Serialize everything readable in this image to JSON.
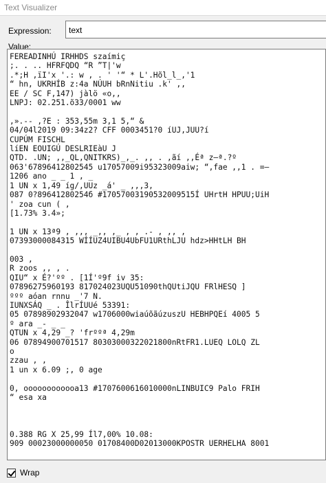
{
  "window": {
    "title": "Text Visualizer"
  },
  "expression": {
    "label": "Expression:",
    "value": "text"
  },
  "value": {
    "label": "Value:",
    "text": "FEREADINHÚ IRHHDS szaímiç\n;. . .. HFRFQDQ “R ”T|'w\n.*;H ,ïI'x '.: w , . ' '“ * L'.Hõl_l_,'1\n“ hn, UKRHÍB z:4a NÚUH bRnNitiu .k' ,,\nEE / SC F,147) jàlö «o,,\nLNPJ: 02.251.õ33/0001 ww\n\n,».-- ,?E : 353,55m 3,1 5,“ &\n04/04l2019 09:34z2? CFF 0003451?0 íUJ,JUU?í\nCUPÚM FISCHL\nlíEN EOUIGÚ DESLRIEàU J\nQTD. .UN; ,,_QL,QNITKRS)_,_. ,, . ,ãí ,,Éª z—ª.?º\n063'67896412802545 u17057009i95323009aiw; “,fae ,,1 . =–\n1206 ano _ _ 1 , _\n1 UN x 1,49 íg/,UUz _á' _ ,,,3,\n087 0?89641280254б #17057003190532009515Í UHrtH HPUU;UiH\n' zoa cun ( ,\n[1.73% 3.4»;\n\n1 UN x 13ª9 , ,,, _,, ,_ , , .- , ,, ,\n07393000084315 WÍÍUZ4UIBU4UbFU1URthLJU hdz>HHtLH BH\n\n003 ,\nR zoos ,, , .\nQIU“ x É?'ºº . [1Í'º9f iv 35:\n07896275960193 817024023UQU51090thQUtiJQU FRlHESQ ]\nººº aóan rnnu _'7 N.\nIUNXSÁQ _ . ÎlrÍUUé 53391:\n05 07898902932047 w1706000wiaúõãúzuszU HEBHPQEí 4005 5\nº ara _- _ _\nQTUN x 4,29 _? 'frººª 4,29m\n06 07894900701517 80303000322021800nRtFR1.LUEQ LOLQ ZL\no\nzzau , ,\n1 un x 6.09 ;, 0 age\n\n0, oooooooooooa13 #1707600616010000nLINBUIC9 Palo FRIH\n“ esa xa\n\n\n\n0.388 RG X 25,99 Íl7,00% 10.08:\n909 00023000000050 01708400D02013000KPOSTR UERHELHA 8001"
  },
  "wrap": {
    "label": "Wrap",
    "checked": true
  }
}
